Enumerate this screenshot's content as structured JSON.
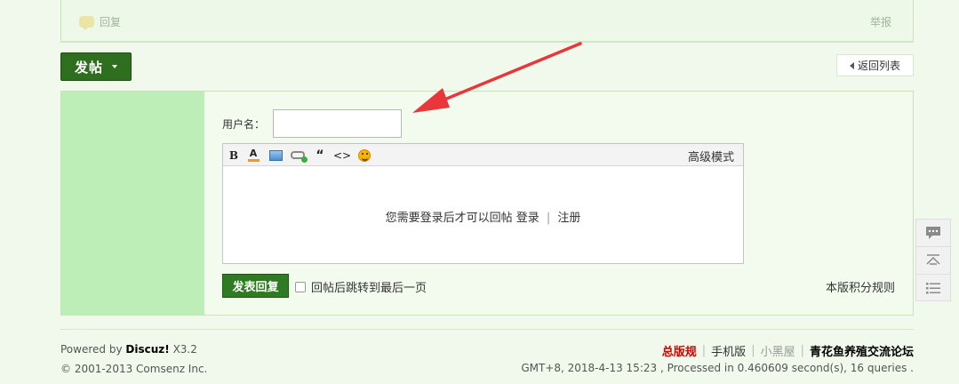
{
  "post_actions": {
    "reply_label": "回复",
    "report_label": "举报"
  },
  "toolbar": {
    "new_post_label": "发帖",
    "back_to_list_label": "返回列表"
  },
  "reply_form": {
    "username_label": "用户名：",
    "username_value": "",
    "editor": {
      "tools": [
        "bold-icon",
        "font-color-icon",
        "image-icon",
        "link-icon",
        "quote-icon",
        "code-icon",
        "smiley-icon"
      ],
      "bold_glyph": "B",
      "color_glyph": "A",
      "quote_glyph": "“",
      "code_glyph": "<>",
      "advanced_mode_label": "高级模式",
      "login_prompt": "您需要登录后才可以回帖",
      "login_link": "登录",
      "separator": "|",
      "register_link": "注册"
    },
    "submit_label": "发表回复",
    "jump_checkbox_label": "回帖后跳转到最后一页",
    "jump_checked": false,
    "rules_link": "本版积分规则"
  },
  "side_tools": [
    "comment-icon",
    "back-to-top-icon",
    "list-icon"
  ],
  "footer": {
    "powered_prefix": "Powered by",
    "powered_brand": "Discuz!",
    "powered_version": "X3.2",
    "copyright": "© 2001-2013 Comsenz Inc.",
    "links": {
      "rules": "总版规",
      "mobile": "手机版",
      "black_room": "小黑屋",
      "forum_name": "青花鱼养殖交流论坛"
    },
    "link_separator": "|",
    "stats": "GMT+8, 2018-4-13 15:23 , Processed in 0.460609 second(s), 16 queries ."
  },
  "colors": {
    "page_bg": "#f0f9ec",
    "accent_green": "#2e6f1f",
    "side_panel": "#bdeeb7",
    "rules_red": "#d40000",
    "annotation_arrow": "#e8363a"
  }
}
